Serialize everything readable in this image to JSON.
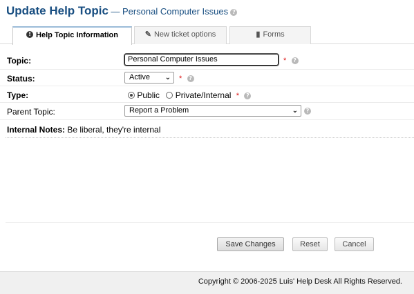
{
  "header": {
    "title": "Update Help Topic",
    "subtitle": "— Personal Computer Issues",
    "help_icon": "help-icon"
  },
  "tabs": [
    {
      "label": "Help Topic Information",
      "icon": "info-icon",
      "active": true
    },
    {
      "label": "New ticket options",
      "icon": "wrench-icon",
      "active": false
    },
    {
      "label": "Forms",
      "icon": "forms-icon",
      "active": false
    }
  ],
  "form": {
    "topic": {
      "label": "Topic:",
      "value": "Personal Computer Issues",
      "required": "*"
    },
    "status": {
      "label": "Status:",
      "value": "Active",
      "required": "*"
    },
    "type": {
      "label": "Type:",
      "options": [
        "Public",
        "Private/Internal"
      ],
      "selected": "Public",
      "required": "*"
    },
    "parent_topic": {
      "label": "Parent Topic:",
      "value": "Report a Problem"
    },
    "internal_notes": {
      "label": "Internal Notes:",
      "hint": "Be liberal, they're internal",
      "value": ""
    }
  },
  "buttons": {
    "save": "Save Changes",
    "reset": "Reset",
    "cancel": "Cancel"
  },
  "footer": {
    "copyright": "Copyright © 2006-2025 Luis' Help Desk All Rights Reserved."
  },
  "colors": {
    "title": "#184e81",
    "required": "#d11111",
    "footer_bg": "#f0f0f0"
  }
}
